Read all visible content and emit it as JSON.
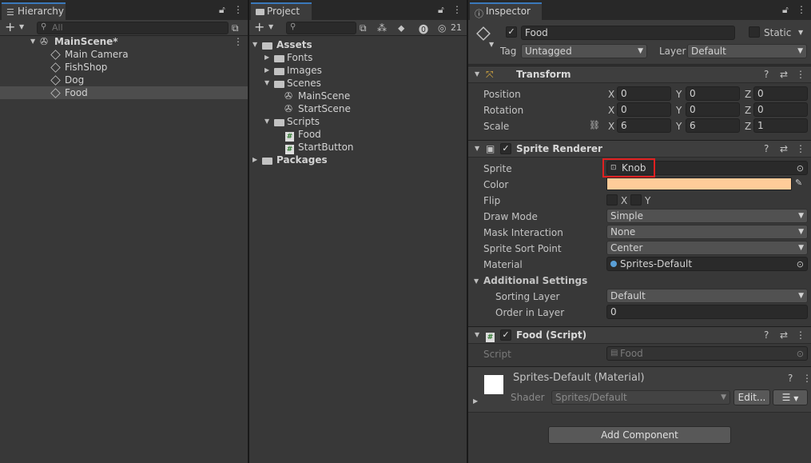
{
  "hierarchy": {
    "tab_label": "Hierarchy",
    "search_placeholder": "All",
    "items": [
      {
        "label": "MainScene*"
      },
      {
        "label": "Main Camera"
      },
      {
        "label": "FishShop"
      },
      {
        "label": "Dog"
      },
      {
        "label": "Food"
      }
    ]
  },
  "project": {
    "tab_label": "Project",
    "hidden_count": "21",
    "tree": [
      {
        "label": "Assets"
      },
      {
        "label": "Fonts"
      },
      {
        "label": "Images"
      },
      {
        "label": "Scenes"
      },
      {
        "label": "MainScene"
      },
      {
        "label": "StartScene"
      },
      {
        "label": "Scripts"
      },
      {
        "label": "Food"
      },
      {
        "label": "StartButton"
      },
      {
        "label": "Packages"
      }
    ]
  },
  "inspector": {
    "tab_label": "Inspector",
    "object_name": "Food",
    "static_label": "Static",
    "tag_label": "Tag",
    "tag_value": "Untagged",
    "layer_label": "Layer",
    "layer_value": "Default",
    "transform": {
      "title": "Transform",
      "position_label": "Position",
      "rotation_label": "Rotation",
      "scale_label": "Scale",
      "x": "X",
      "y": "Y",
      "z": "Z",
      "position": [
        "0",
        "0",
        "0"
      ],
      "rotation": [
        "0",
        "0",
        "0"
      ],
      "scale": [
        "6",
        "6",
        "1"
      ]
    },
    "sprite_renderer": {
      "title": "Sprite Renderer",
      "sprite_label": "Sprite",
      "sprite_value": "Knob",
      "color_label": "Color",
      "color_value": "#ffcc99",
      "flip_label": "Flip",
      "flip_x": "X",
      "flip_y": "Y",
      "draw_mode_label": "Draw Mode",
      "draw_mode_value": "Simple",
      "mask_label": "Mask Interaction",
      "mask_value": "None",
      "sort_point_label": "Sprite Sort Point",
      "sort_point_value": "Center",
      "material_label": "Material",
      "material_value": "Sprites-Default",
      "additional_label": "Additional Settings",
      "sorting_layer_label": "Sorting Layer",
      "sorting_layer_value": "Default",
      "order_label": "Order in Layer",
      "order_value": "0"
    },
    "food_script": {
      "title": "Food (Script)",
      "script_label": "Script",
      "script_value": "Food"
    },
    "material": {
      "title": "Sprites-Default (Material)",
      "shader_label": "Shader",
      "shader_value": "Sprites/Default",
      "edit_label": "Edit..."
    },
    "add_component_label": "Add Component"
  },
  "colors": {
    "highlight_box": "#e02020",
    "selection": "#4d4d4d"
  }
}
